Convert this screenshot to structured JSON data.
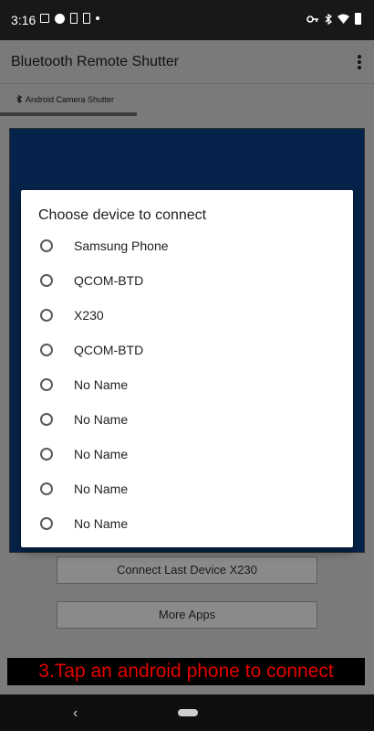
{
  "status_bar": {
    "time": "3:16",
    "left_icons": [
      "image-icon",
      "shield-icon",
      "sim-icon",
      "document-icon",
      "dot-icon"
    ],
    "right_icons": [
      "key-icon",
      "bluetooth-icon",
      "wifi-icon",
      "battery-icon"
    ]
  },
  "app_bar": {
    "title": "Bluetooth Remote Shutter"
  },
  "tabs": [
    {
      "label": "Android Camera Shutter",
      "icon": "bluetooth-icon"
    }
  ],
  "background_buttons": {
    "connect_last": "Connect Last Device X230",
    "more_apps": "More Apps"
  },
  "banner": {
    "text": "3.Tap an android phone to connect",
    "color": "#e30000"
  },
  "dialog": {
    "title": "Choose device to connect",
    "devices": [
      {
        "label": "Samsung Phone"
      },
      {
        "label": "QCOM-BTD"
      },
      {
        "label": "X230"
      },
      {
        "label": "QCOM-BTD"
      },
      {
        "label": "No Name"
      },
      {
        "label": "No Name"
      },
      {
        "label": "No Name"
      },
      {
        "label": "No Name"
      },
      {
        "label": "No Name"
      }
    ]
  },
  "colors": {
    "panel": "#06244b",
    "scrim": "#7b7b7b",
    "dialog_bg": "#ffffff"
  }
}
